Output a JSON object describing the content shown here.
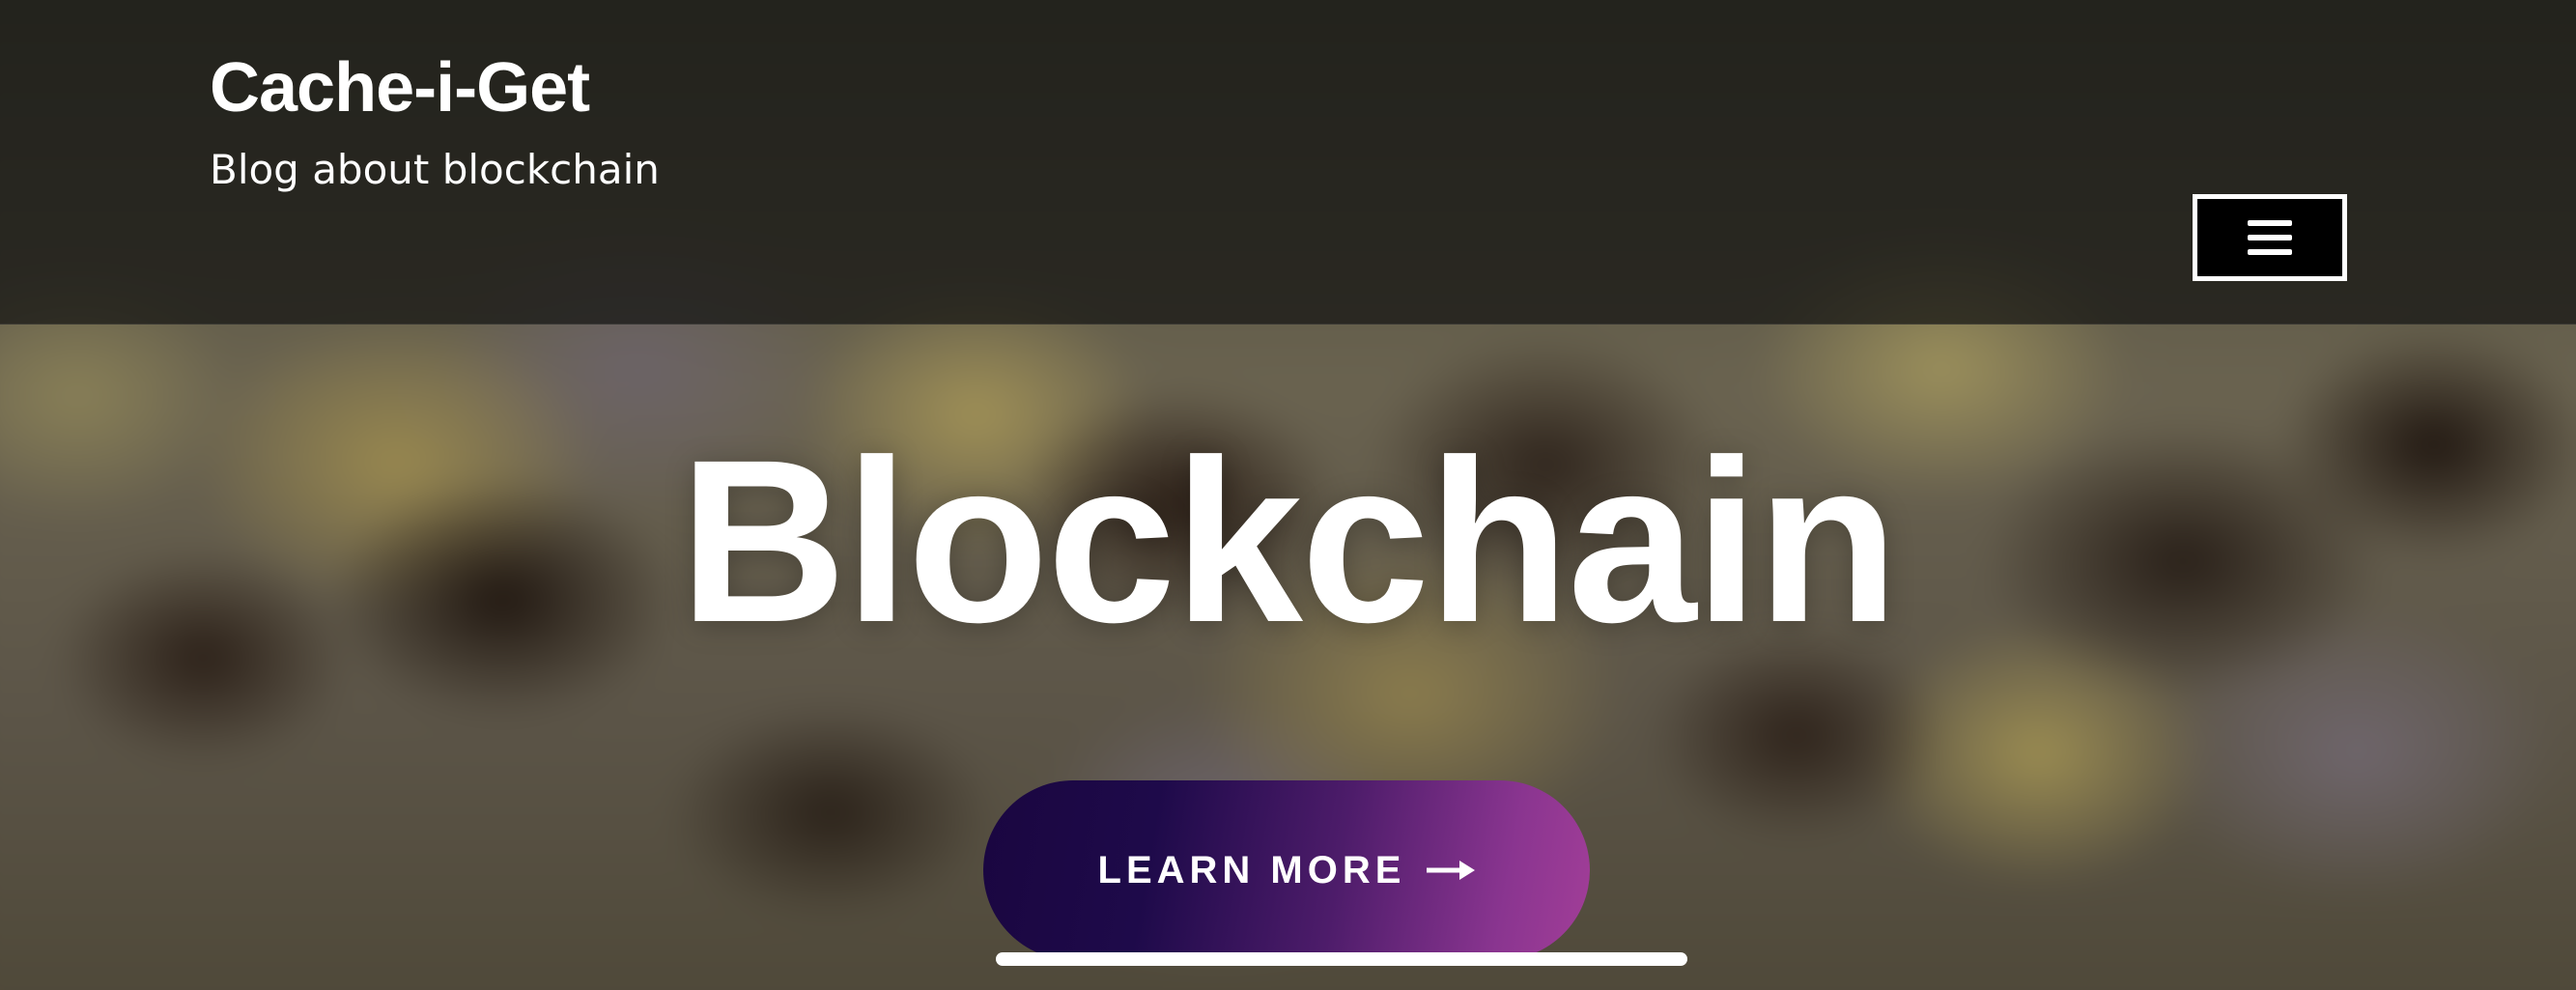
{
  "site": {
    "title": "Cache-i-Get",
    "tagline": "Blog about blockchain"
  },
  "header": {
    "menu_icon": "hamburger-icon"
  },
  "hero": {
    "title": "Blockchain",
    "cta_label": "LEARN MORE",
    "cta_icon": "arrow-right-icon",
    "cta_gradient": [
      "#1a0640",
      "#a23e98"
    ]
  },
  "colors": {
    "text": "#ffffff",
    "menu_button_bg": "#000000"
  }
}
